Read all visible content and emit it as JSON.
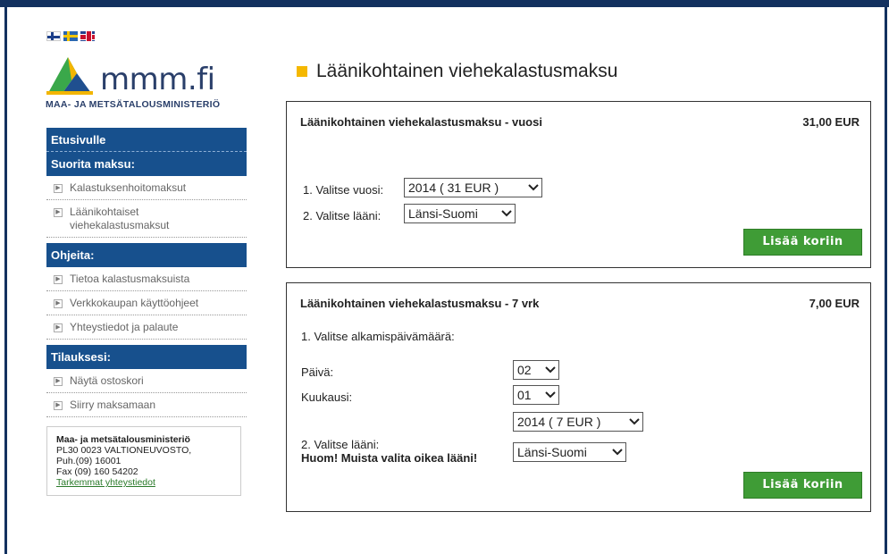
{
  "colors": {
    "nav": "#17508d",
    "frame": "#13315f",
    "button": "#3f9c36",
    "accent": "#f5b800"
  },
  "languages": [
    {
      "code": "fi",
      "icon": "finnish-flag-icon"
    },
    {
      "code": "sv",
      "icon": "swedish-flag-icon"
    },
    {
      "code": "en",
      "icon": "british-flag-icon"
    }
  ],
  "logo": {
    "text": "mmm.fi",
    "subtitle": "MAA- JA METSÄTALOUSMINISTERIÖ"
  },
  "sidebar": {
    "home": "Etusivulle",
    "pay_heading": "Suorita maksu:",
    "pay_items": [
      "Kalastuksenhoitomaksut",
      "Läänikohtaiset viehekalastusmaksut"
    ],
    "help_heading": "Ohjeita:",
    "help_items": [
      "Tietoa kalastusmaksuista",
      "Verkkokaupan käyttöohjeet",
      "Yhteystiedot ja palaute"
    ],
    "orders_heading": "Tilauksesi:",
    "order_items": [
      "Näytä ostoskori",
      "Siirry maksamaan"
    ],
    "contact": {
      "org": "Maa- ja metsätalousministeriö",
      "address": "PL30 0023 VALTIONEUVOSTO,",
      "phone": "Puh.(09) 16001",
      "fax": "Fax (09) 160 54202",
      "link": "Tarkemmat yhteystiedot"
    }
  },
  "main": {
    "title": "Läänikohtainen viehekalastusmaksu",
    "year_panel": {
      "title": "Läänikohtainen viehekalastusmaksu - vuosi",
      "price": "31,00 EUR",
      "year_label": "1. Valitse vuosi:",
      "year_value": "2014 ( 31 EUR )",
      "province_label": "2. Valitse lääni:",
      "province_value": "Länsi-Suomi",
      "add_button": "Lisää koriin"
    },
    "week_panel": {
      "title": "Läänikohtainen viehekalastusmaksu - 7 vrk",
      "price": "7,00 EUR",
      "start_label": "1. Valitse alkamispäivämäärä:",
      "day_label": "Päivä:",
      "day_value": "02",
      "month_label": "Kuukausi:",
      "month_value": "01",
      "year_value": "2014 ( 7 EUR )",
      "province_label": "2. Valitse lääni:",
      "province_note": "Huom! Muista valita oikea lääni!",
      "province_value": "Länsi-Suomi",
      "add_button": "Lisää koriin"
    }
  }
}
